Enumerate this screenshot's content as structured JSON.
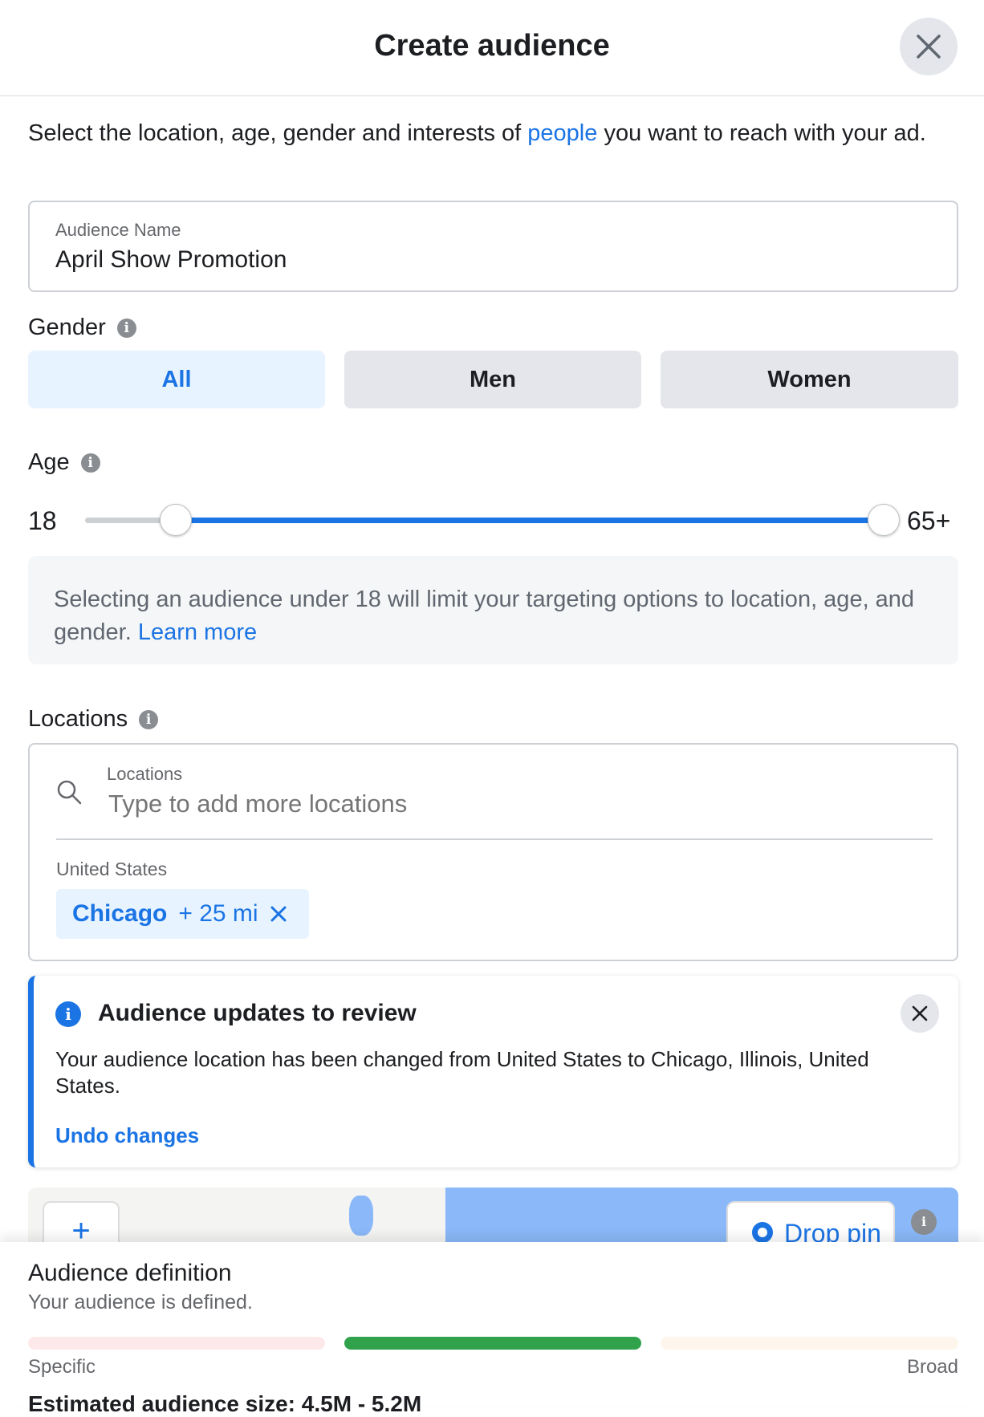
{
  "header": {
    "title": "Create audience",
    "close_icon": "close-icon"
  },
  "intro": {
    "before": "Select the location, age, gender and interests of ",
    "link": "people",
    "after": " you want to reach with your ad."
  },
  "audience_name": {
    "label": "Audience Name",
    "value": "April Show Promotion"
  },
  "gender": {
    "label": "Gender",
    "options": [
      "All",
      "Men",
      "Women"
    ],
    "selected": "All"
  },
  "age": {
    "label": "Age",
    "min": "18",
    "max": "65+",
    "min_fraction": 0.12,
    "max_fraction": 1.0
  },
  "age_note": {
    "text": "Selecting an audience under 18 will limit your targeting options to location, age, and gender. ",
    "link": "Learn more"
  },
  "locations": {
    "label": "Locations",
    "field_label": "Locations",
    "placeholder": "Type to add more locations",
    "country": "United States",
    "chip": {
      "name": "Chicago",
      "radius": "+ 25 mi"
    }
  },
  "notice": {
    "title": "Audience updates to review",
    "body": "Your audience location has been changed from United States to Chicago, Illinois, United States.",
    "action": "Undo changes"
  },
  "map": {
    "zoom_in": "+",
    "drop_pin": "Drop pin"
  },
  "definition": {
    "title": "Audience definition",
    "status": "Your audience is defined.",
    "left": "Specific",
    "right": "Broad",
    "estimated": "Estimated audience size: 4.5M - 5.2M",
    "level": "middle",
    "colors": {
      "specific": "#fde8ea",
      "defined": "#31a24c",
      "broad": "#fef6ec"
    }
  },
  "colors": {
    "accent": "#1b74e4",
    "selected_bg": "#e7f3ff"
  }
}
